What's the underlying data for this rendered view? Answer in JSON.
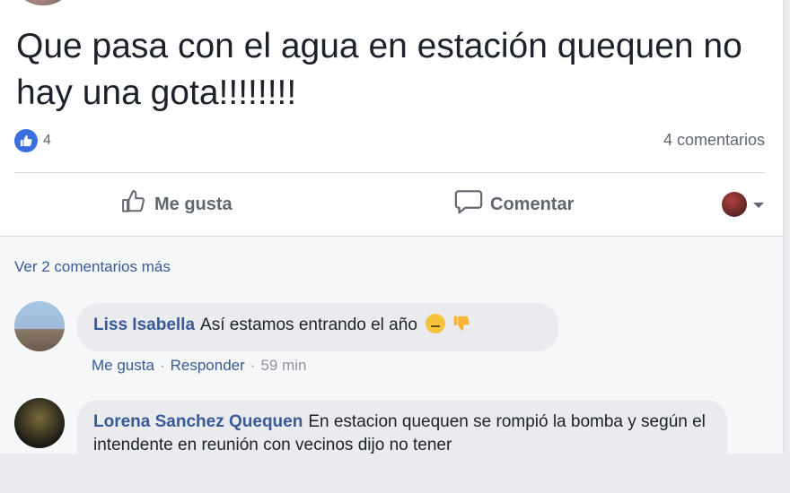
{
  "post": {
    "text": "Que pasa con el agua en estación quequen no hay una gota!!!!!!!!",
    "reaction_count": "4",
    "comment_count": "4 comentarios"
  },
  "actions": {
    "like": "Me gusta",
    "comment": "Comentar"
  },
  "comments": {
    "view_more": "Ver 2 comentarios más",
    "items": [
      {
        "author": "Liss Isabella",
        "text": "Así estamos entrando el año",
        "meta": {
          "like": "Me gusta",
          "reply": "Responder",
          "time": "59 min"
        }
      },
      {
        "author": "Lorena Sanchez Quequen",
        "text": "En estacion quequen se rompió la bomba y según el intendente en reunión con vecinos dijo no tener"
      }
    ]
  },
  "colors": {
    "link": "#385898",
    "like_badge": "#3b6fe0",
    "muted": "#606770"
  }
}
